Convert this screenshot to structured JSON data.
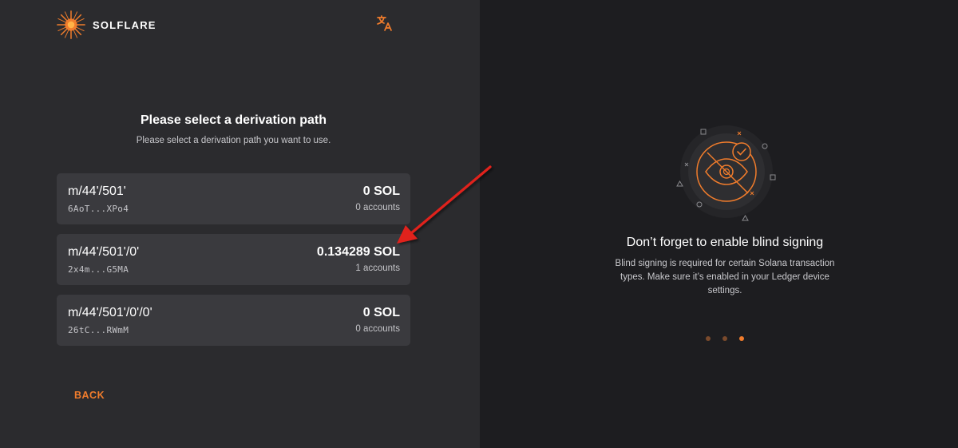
{
  "app": {
    "name": "SOLFLARE"
  },
  "header": {
    "language_icon": "translate-icon"
  },
  "main": {
    "title": "Please select a derivation path",
    "subtitle": "Please select a derivation path you want to use.",
    "paths": [
      {
        "path": "m/44'/501'",
        "address": "6AoT...XPo4",
        "balance": "0 SOL",
        "accounts": "0 accounts"
      },
      {
        "path": "m/44'/501'/0'",
        "address": "2x4m...G5MA",
        "balance": "0.134289 SOL",
        "accounts": "1 accounts"
      },
      {
        "path": "m/44'/501'/0'/0'",
        "address": "26tC...RWmM",
        "balance": "0 SOL",
        "accounts": "0 accounts"
      }
    ],
    "back_label": "BACK"
  },
  "info": {
    "title": "Don’t forget to enable blind signing",
    "text": "Blind signing is required for certain Solana transaction types. Make sure it’s enabled in your Ledger device settings.",
    "illustration_icon": "blind-signing-eye-icon",
    "carousel": {
      "count": 3,
      "active": 3
    }
  },
  "colors": {
    "accent": "#f07c2c",
    "annotation": "#e0201b"
  }
}
